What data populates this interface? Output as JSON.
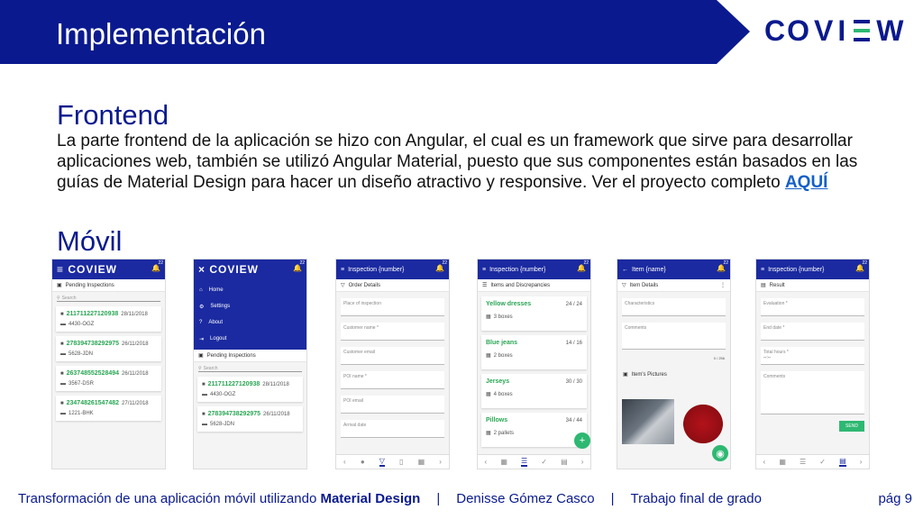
{
  "header": {
    "title": "Implementación"
  },
  "logo": {
    "left": "CO",
    "v": "V",
    "i": "I",
    "right": "W"
  },
  "frontend": {
    "heading": "Frontend",
    "text": "La parte frontend de la aplicación se hizo con Angular, el cual es un framework que sirve para desarrollar aplicaciones web, también se utilizó Angular Material, puesto que sus componentes están basados en las guías de Material Design para hacer un diseño atractivo y responsive. Ver el proyecto completo ",
    "link": "AQUÍ"
  },
  "movil": {
    "heading": "Móvil"
  },
  "screens": {
    "s1": {
      "logo": "≡ COVIEW",
      "badge": "22",
      "sub": "Pending Inspections",
      "search": "Search",
      "items": [
        {
          "code": "211711227120938",
          "date": "28/11/2018",
          "plate": "4430-OGZ"
        },
        {
          "code": "278394738292975",
          "date": "26/11/2018",
          "plate": "5628-JDN"
        },
        {
          "code": "263748552528494",
          "date": "26/11/2018",
          "plate": "3567-DSR"
        },
        {
          "code": "234748261547482",
          "date": "27/11/2018",
          "plate": "1221-BHK"
        }
      ]
    },
    "s2": {
      "logo": "× COVIEW",
      "badge": "22",
      "menu": [
        "Home",
        "Settings",
        "About",
        "Logout"
      ],
      "sub": "Pending Inspections",
      "search": "Search",
      "items": [
        {
          "code": "211711227120938",
          "date": "28/11/2018",
          "plate": "4430-OGZ"
        },
        {
          "code": "278394738292975",
          "date": "26/11/2018",
          "plate": "5628-JDN"
        }
      ]
    },
    "s3": {
      "title": "Inspection {number}",
      "badge": "22",
      "sub": "Order Details",
      "fields": [
        "Place of inspection",
        "Customer name *",
        "Customer email",
        "POI name *",
        "POI email",
        "Arrival date"
      ]
    },
    "s4": {
      "title": "Inspection {number}",
      "badge": "22",
      "sub": "Items and Discrepancies",
      "items": [
        {
          "name": "Yellow dresses",
          "count": "24 / 24",
          "boxes": "3 boxes"
        },
        {
          "name": "Blue jeans",
          "count": "14 / 16",
          "boxes": "2 boxes"
        },
        {
          "name": "Jerseys",
          "count": "30 / 30",
          "boxes": "4 boxes"
        },
        {
          "name": "Pillows",
          "count": "34 / 44",
          "boxes": "2 pallets"
        }
      ]
    },
    "s5": {
      "title": "Item {name}",
      "badge": "22",
      "sub": "Item Details",
      "fields": [
        "Characteristics",
        "Comments"
      ],
      "counter": "0 / 256",
      "pictures": "Item's Pictures"
    },
    "s6": {
      "title": "Inspection {number}",
      "badge": "22",
      "sub": "Result",
      "fields": [
        "Evaluation *",
        "End date *",
        "Total hours *",
        "Comments"
      ],
      "hours": "--:--",
      "send": "SEND"
    }
  },
  "footer": {
    "part1": "Transformación de una aplicación móvil utilizando ",
    "bold": "Material Design",
    "sep": "|",
    "author": "Denisse Gómez Casco",
    "thesis": "Trabajo final de grado",
    "page": "pág 9"
  }
}
